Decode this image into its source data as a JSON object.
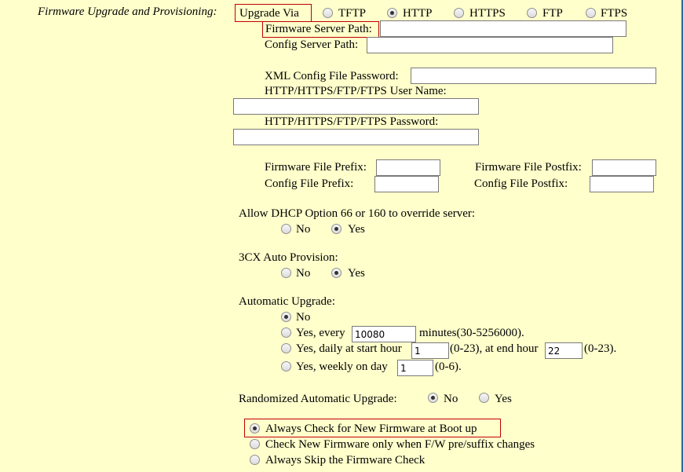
{
  "firmware": {
    "section_label": "Firmware Upgrade and Provisioning:",
    "upgrade_via_label": "Upgrade Via",
    "protocols": [
      "TFTP",
      "HTTP",
      "HTTPS",
      "FTP",
      "FTPS"
    ],
    "selected_protocol": "HTTP",
    "firmware_server_path_label": "Firmware Server Path:",
    "firmware_server_path_value": "",
    "config_server_path_label": "Config Server Path:",
    "config_server_path_value": "",
    "xml_password_label": "XML Config File Password:",
    "xml_password_value": "",
    "user_name_label": "HTTP/HTTPS/FTP/FTPS User Name:",
    "user_name_value": "",
    "password_label": "HTTP/HTTPS/FTP/FTPS Password:",
    "password_value": "",
    "fw_prefix_label": "Firmware File Prefix:",
    "fw_prefix_value": "",
    "fw_postfix_label": "Firmware File Postfix:",
    "fw_postfix_value": "",
    "cfg_prefix_label": "Config File Prefix:",
    "cfg_prefix_value": "",
    "cfg_postfix_label": "Config File Postfix:",
    "cfg_postfix_value": ""
  },
  "dhcp_option": {
    "label": "Allow DHCP Option 66 or 160 to override server:",
    "no_label": "No",
    "yes_label": "Yes",
    "selected": "Yes"
  },
  "auto_provision_3cx": {
    "label": "3CX Auto Provision:",
    "no_label": "No",
    "yes_label": "Yes",
    "selected": "Yes"
  },
  "automatic_upgrade": {
    "label": "Automatic Upgrade:",
    "selected": "No",
    "no_label": "No",
    "every_prefix": "Yes, every",
    "every_value": "10080",
    "every_suffix": "minutes(30-5256000).",
    "daily_prefix": "Yes, daily at start hour",
    "daily_start_value": "1",
    "daily_mid": "(0-23), at end hour",
    "daily_end_value": "22",
    "daily_suffix": "(0-23).",
    "weekly_prefix": "Yes, weekly on day",
    "weekly_value": "1",
    "weekly_suffix": "(0-6)."
  },
  "randomized_upgrade": {
    "label": "Randomized Automatic Upgrade:",
    "no_label": "No",
    "yes_label": "Yes",
    "selected": "No"
  },
  "boot_check": {
    "options": [
      "Always Check for New Firmware at Boot up",
      "Check New Firmware only when F/W pre/suffix changes",
      "Always Skip the Firmware Check"
    ],
    "selected_index": 0
  }
}
